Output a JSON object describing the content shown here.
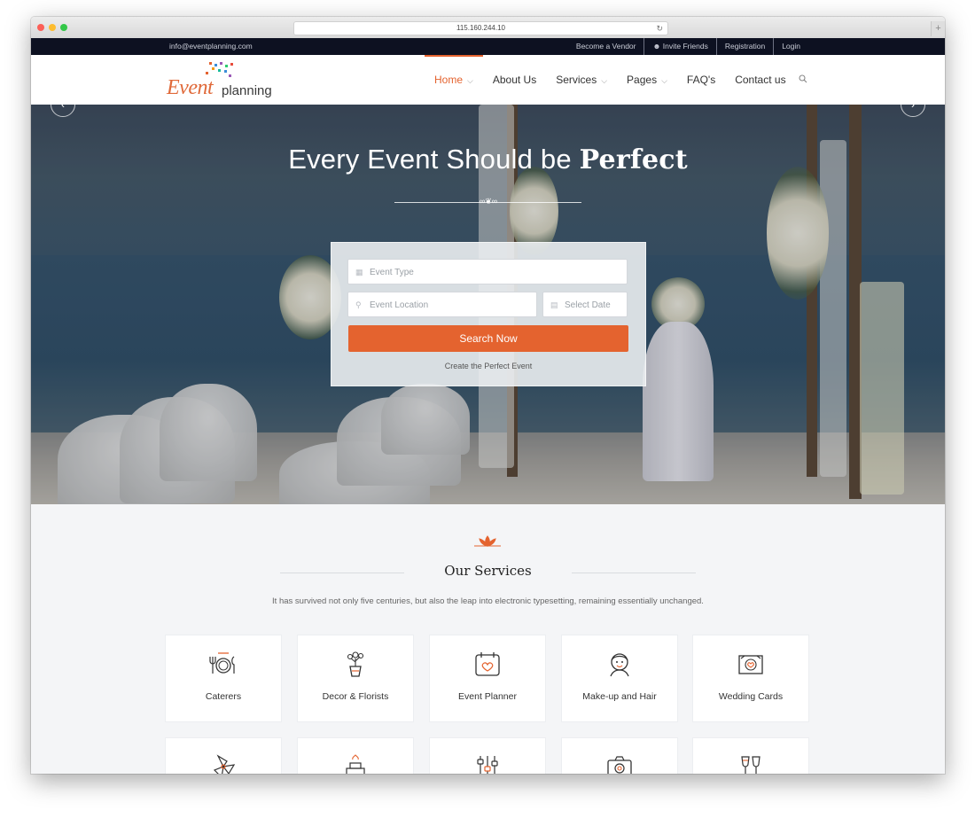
{
  "browser": {
    "url": "115.160.244.10",
    "reload_icon": "reload-icon",
    "new_tab_icon": "plus-icon"
  },
  "topbar": {
    "email": "info@eventplanning.com",
    "links": [
      "Become a Vendor",
      "Invite Friends",
      "Registration",
      "Login"
    ]
  },
  "logo": {
    "word1": "Event",
    "word2": "planning"
  },
  "nav": {
    "items": [
      {
        "label": "Home",
        "dropdown": true
      },
      {
        "label": "About Us",
        "dropdown": false
      },
      {
        "label": "Services",
        "dropdown": true
      },
      {
        "label": "Pages",
        "dropdown": true
      },
      {
        "label": "FAQ's",
        "dropdown": false
      },
      {
        "label": "Contact us",
        "dropdown": false
      }
    ],
    "active": "Home",
    "accent": "#e4632f"
  },
  "hero": {
    "title_light": "Every Event Should be",
    "title_bold": "Perfect",
    "search": {
      "event_type_placeholder": "Event Type",
      "location_placeholder": "Event Location",
      "date_placeholder": "Select Date",
      "button": "Search Now",
      "subtext": "Create the Perfect Event"
    }
  },
  "services": {
    "title": "Our Services",
    "description": "It has survived not only five centuries, but also the leap into electronic typesetting, remaining essentially unchanged.",
    "cards": [
      {
        "label": "Caterers",
        "icon": "dining-icon"
      },
      {
        "label": "Decor & Florists",
        "icon": "flower-pot-icon"
      },
      {
        "label": "Event Planner",
        "icon": "calendar-heart-icon"
      },
      {
        "label": "Make-up and Hair",
        "icon": "makeup-face-icon"
      },
      {
        "label": "Wedding Cards",
        "icon": "card-heart-icon"
      }
    ],
    "second_row_icons": [
      "pinwheel-icon",
      "cake-icon",
      "music-mixer-icon",
      "camera-icon",
      "wine-glasses-icon"
    ]
  }
}
